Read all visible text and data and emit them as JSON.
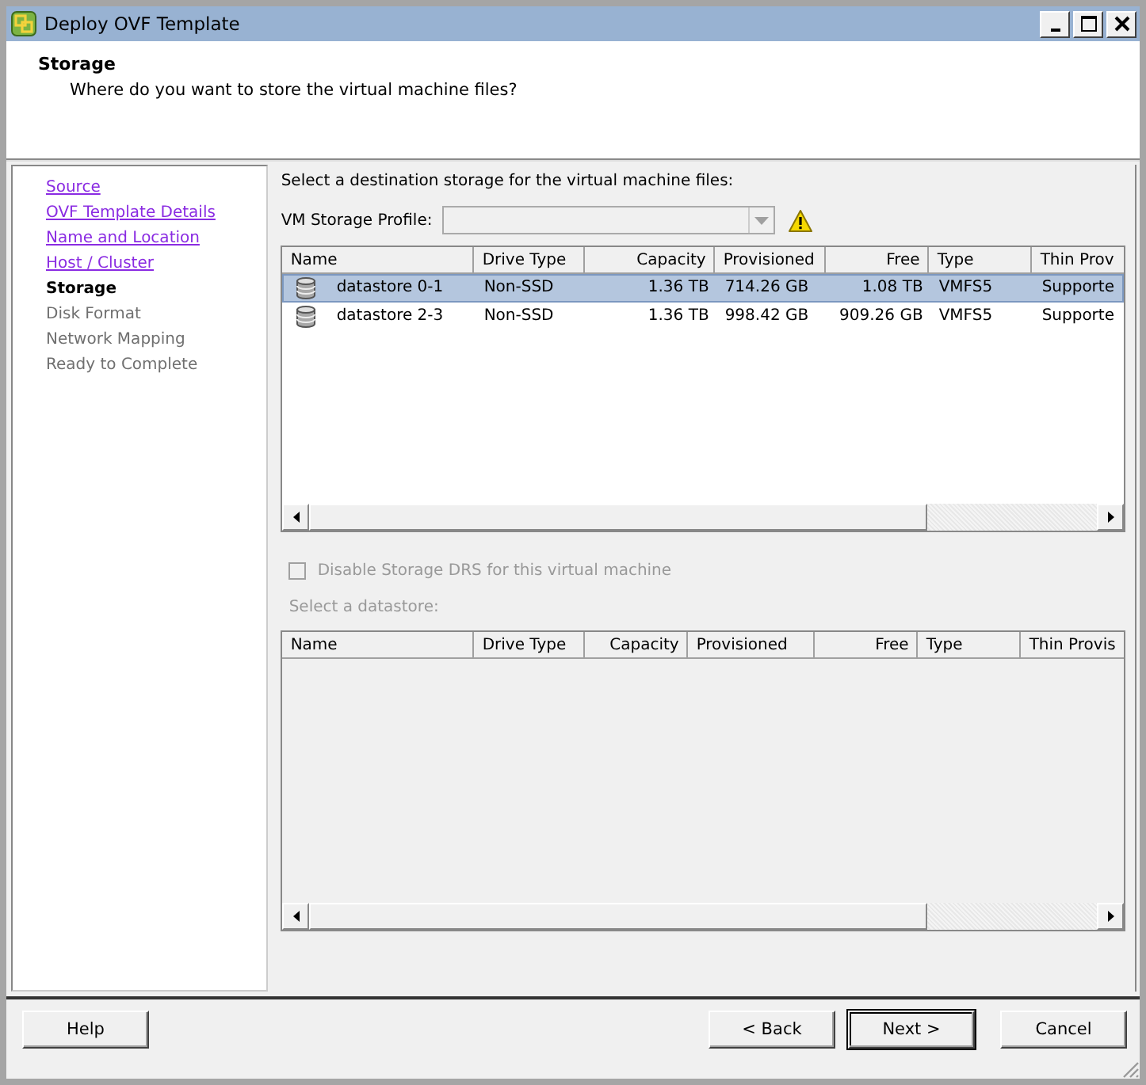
{
  "window": {
    "title": "Deploy OVF Template"
  },
  "header": {
    "title": "Storage",
    "subtitle": "Where do you want to store the virtual machine files?"
  },
  "steps": [
    {
      "label": "Source",
      "visited": true,
      "selected": false
    },
    {
      "label": "OVF Template Details",
      "visited": true,
      "selected": false
    },
    {
      "label": "Name and Location",
      "visited": true,
      "selected": false
    },
    {
      "label": "Host / Cluster",
      "visited": true,
      "selected": false
    },
    {
      "label": "Storage",
      "visited": false,
      "selected": true
    },
    {
      "label": "Disk Format",
      "visited": false,
      "selected": false
    },
    {
      "label": "Network Mapping",
      "visited": false,
      "selected": false
    },
    {
      "label": "Ready to Complete",
      "visited": false,
      "selected": false
    }
  ],
  "instruction": "Select a destination storage for the virtual machine files:",
  "profile": {
    "label": "VM Storage Profile:",
    "disabled": true
  },
  "storage_table": {
    "columns": [
      {
        "label": "Name",
        "numeric": false
      },
      {
        "label": "Drive Type",
        "numeric": false
      },
      {
        "label": "Capacity",
        "numeric": true
      },
      {
        "label": "Provisioned",
        "numeric": false
      },
      {
        "label": "Free",
        "numeric": true
      },
      {
        "label": "Type",
        "numeric": false
      },
      {
        "label": "Thin Prov",
        "numeric": false
      }
    ],
    "rows": [
      {
        "selected": true,
        "cells": [
          "datastore 0-1",
          "Non-SSD",
          "1.36 TB",
          "714.26 GB",
          "1.08 TB",
          "VMFS5",
          "Supporte"
        ]
      },
      {
        "selected": false,
        "cells": [
          "datastore 2-3",
          "Non-SSD",
          "1.36 TB",
          "998.42 GB",
          "909.26 GB",
          "VMFS5",
          "Supporte"
        ]
      }
    ]
  },
  "drs_checkbox": {
    "label": "Disable Storage DRS for this virtual machine",
    "checked": false,
    "disabled": true
  },
  "datastore_section": {
    "label": "Select a datastore:",
    "disabled": true,
    "columns": [
      {
        "label": "Name",
        "numeric": false
      },
      {
        "label": "Drive Type",
        "numeric": false
      },
      {
        "label": "Capacity",
        "numeric": true
      },
      {
        "label": "Provisioned",
        "numeric": false
      },
      {
        "label": "Free",
        "numeric": true
      },
      {
        "label": "Type",
        "numeric": false
      },
      {
        "label": "Thin Provis",
        "numeric": false
      }
    ]
  },
  "help_button": "Help",
  "nav_buttons": [
    {
      "label": "< Back",
      "default": false
    },
    {
      "label": "Next >",
      "default": true
    },
    {
      "label": "Cancel",
      "default": false
    }
  ]
}
